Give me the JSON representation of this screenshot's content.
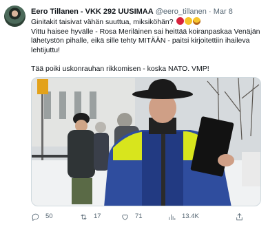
{
  "tweet": {
    "author_name": "Eero Tillanen - VKK 292 UUSIMAA",
    "handle": "@eero_tillanen",
    "separator": "·",
    "date": "Mar 8",
    "text_line1": "Ginitakit taisivat vähän suuttua, miksiköhän?",
    "text_line2": "Vittu haisee hyvälle - Rosa Meriläinen sai heittää koiranpaskaa Venäjän lähetystön pihalle, eikä sille tehty MITÄÄN - paitsi kirjoitettiin ihaileva lehtijuttu!",
    "text_line3": "Tää poiki uskonrauhan rikkomisen - koska NATO. VMP!",
    "emojis": [
      "angry-face-emoji",
      "rolling-laughing-emoji",
      "cowboy-face-emoji"
    ]
  },
  "actions": {
    "replies": "50",
    "retweets": "17",
    "likes": "71",
    "views": "13.4K"
  },
  "colors": {
    "text": "#0f1419",
    "secondary": "#536471",
    "border": "#cfd9de"
  }
}
